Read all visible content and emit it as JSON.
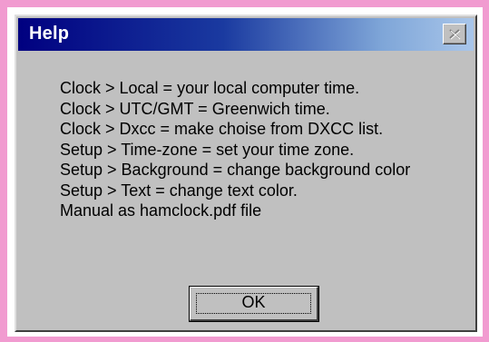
{
  "window": {
    "title": "Help",
    "close_icon": "close-icon"
  },
  "help_text": {
    "lines": [
      "Clock > Local = your local computer time.",
      "Clock > UTC/GMT = Greenwich time.",
      "Clock > Dxcc = make choise from DXCC list.",
      "Setup > Time-zone = set your time zone.",
      "Setup > Background = change background color",
      "Setup > Text = change text color.",
      "Manual as hamclock.pdf file"
    ]
  },
  "buttons": {
    "ok_label": "OK"
  },
  "colors": {
    "frame_pink": "#f19bd0",
    "dialog_gray": "#c0c0c0",
    "titlebar_start": "#000080",
    "titlebar_end": "#a9c6ea"
  }
}
